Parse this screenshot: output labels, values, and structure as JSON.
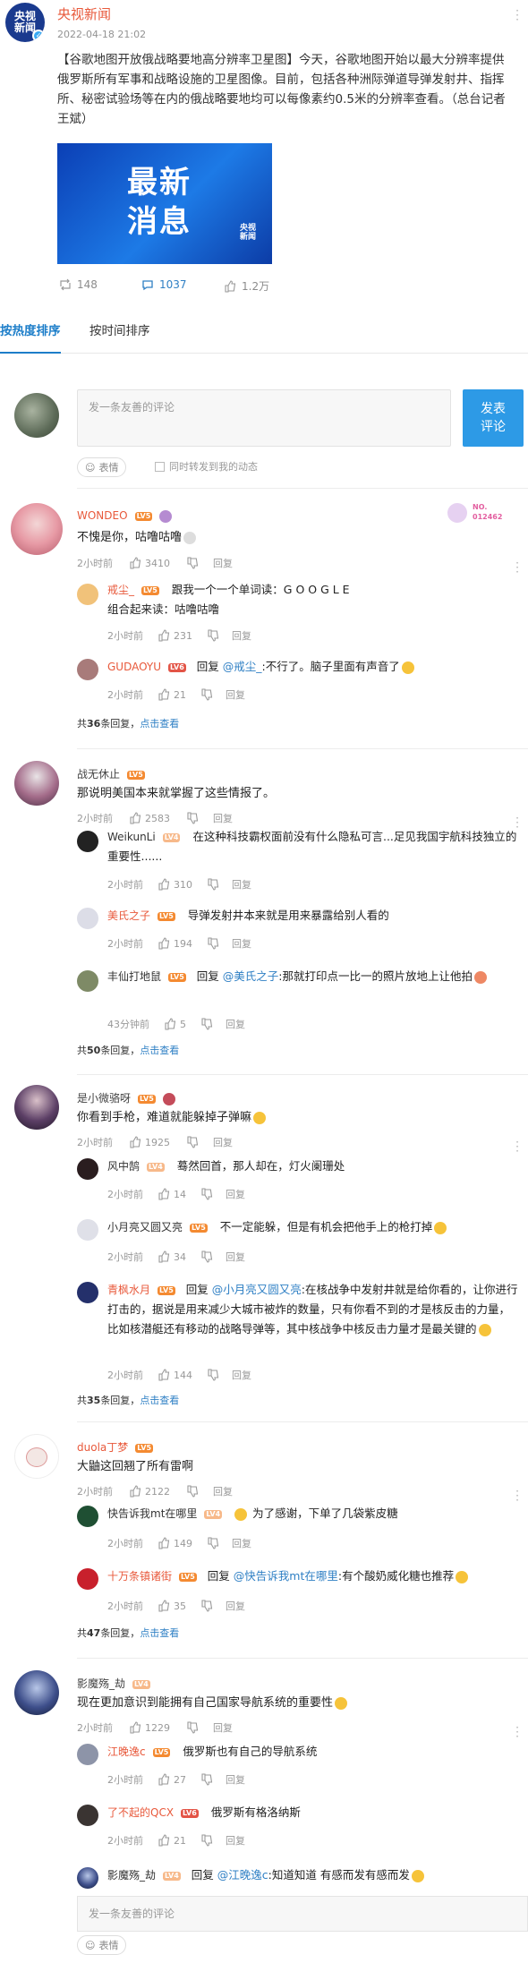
{
  "post": {
    "author": "央视新闻",
    "avatar_line1": "央视",
    "avatar_line2": "新闻",
    "time": "2022-04-18 21:02",
    "text": "【谷歌地图开放俄战略要地高分辨率卫星图】今天，谷歌地图开始以最大分辨率提供俄罗斯所有军事和战略设施的卫星图像。目前，包括各种洲际弹道导弹发射井、指挥所、秘密试验场等在内的俄战略要地均可以每像素约0.5米的分辨率查看。（总台记者王斌）",
    "image_title_line1": "最新",
    "image_title_line2": "消息",
    "image_logo_line1": "央视",
    "image_logo_line2": "新闻",
    "reposts": "148",
    "comments": "1037",
    "likes": "1.2万"
  },
  "tabs": [
    "按热度排序",
    "按时间排序"
  ],
  "composer": {
    "placeholder": "发一条友善的评论",
    "send_line1": "发表",
    "send_line2": "评论",
    "emoji_label": "表情",
    "also_post_label": "同时转发到我的动态"
  },
  "comments": [
    {
      "name": "WONDEO",
      "level": "LV5",
      "text": "不愧是你，咕噜咕噜",
      "time": "2小时前",
      "likes": "3410",
      "reply_label": "回复",
      "badge": "NO.",
      "badge_num": "012462",
      "replies": [
        {
          "name": "戒尘_",
          "level": "LV5",
          "text": "跟我一个一个单词读：G O O G L E",
          "text2": "组合起来读：咕噜咕噜",
          "time": "2小时前",
          "likes": "231"
        },
        {
          "name": "GUDAOYU",
          "level": "LV6",
          "prefix": "回复",
          "mention": "@戒尘_",
          "text": ":不行了。脑子里面有声音了",
          "time": "2小时前",
          "likes": "21"
        }
      ],
      "more_prefix": "共",
      "more_count": "36",
      "more_suffix": "条回复，",
      "more_link": "点击查看"
    },
    {
      "name": "战无休止",
      "level": "LV5",
      "text": "那说明美国本来就掌握了这些情报了。",
      "time": "2小时前",
      "likes": "2583",
      "reply_label": "回复",
      "replies": [
        {
          "name": "WeikunLi",
          "level": "LV4",
          "text": "在这种科技霸权面前没有什么隐私可言...足见我国宇航科技独立的重要性......",
          "time": "2小时前",
          "likes": "310"
        },
        {
          "name": "美氏之子",
          "level": "LV5",
          "text": "导弹发射井本来就是用来暴露给别人看的",
          "time": "2小时前",
          "likes": "194"
        },
        {
          "name": "丰仙打地鼠",
          "level": "LV5",
          "prefix": "回复",
          "mention": "@美氏之子",
          "text": ":那就打印点一比一的照片放地上让他拍",
          "time": "43分钟前",
          "likes": "5"
        }
      ],
      "more_prefix": "共",
      "more_count": "50",
      "more_suffix": "条回复，",
      "more_link": "点击查看"
    },
    {
      "name": "是小微骆呀",
      "level": "LV5",
      "text": "你看到手枪，难道就能躲掉子弹嘛",
      "time": "2小时前",
      "likes": "1925",
      "reply_label": "回复",
      "replies": [
        {
          "name": "风中鹄",
          "level": "LV4",
          "text": "蓦然回首，那人却在，灯火阑珊处",
          "time": "2小时前",
          "likes": "14"
        },
        {
          "name": "小月亮又圆又亮",
          "level": "LV5",
          "text": "不一定能躲，但是有机会把他手上的枪打掉",
          "time": "2小时前",
          "likes": "34"
        },
        {
          "name": "青枫水月",
          "level": "LV5",
          "prefix": "回复",
          "mention": "@小月亮又圆又亮",
          "text": ":在核战争中发射井就是给你看的，让你进行打击的，据说是用来减少大城市被炸的数量，只有你看不到的才是核反击的力量，比如核潜艇还有移动的战略导弹等，其中核战争中核反击力量才是最关键的",
          "time": "2小时前",
          "likes": "144"
        }
      ],
      "more_prefix": "共",
      "more_count": "35",
      "more_suffix": "条回复，",
      "more_link": "点击查看"
    },
    {
      "name": "duola丁梦",
      "level": "LV5",
      "text": "大鼬这回翘了所有雷啊",
      "time": "2小时前",
      "likes": "2122",
      "reply_label": "回复",
      "replies": [
        {
          "name": "快告诉我mt在哪里",
          "level": "LV4",
          "text": "为了感谢，下单了几袋紫皮糖",
          "time": "2小时前",
          "likes": "149"
        },
        {
          "name": "十万条镇诸街",
          "level": "LV5",
          "prefix": "回复",
          "mention": "@快告诉我mt在哪里",
          "text": ":有个酸奶威化糖也推荐",
          "time": "2小时前",
          "likes": "35"
        }
      ],
      "more_prefix": "共",
      "more_count": "47",
      "more_suffix": "条回复，",
      "more_link": "点击查看"
    },
    {
      "name": "影魔殇_劫",
      "level": "LV4",
      "text": "现在更加意识到能拥有自己国家导航系统的重要性",
      "time": "2小时前",
      "likes": "1229",
      "reply_label": "回复",
      "replies": [
        {
          "name": "江晚逸c",
          "level": "LV5",
          "text": "俄罗斯也有自己的导航系统",
          "time": "2小时前",
          "likes": "27"
        },
        {
          "name": "了不起的QCX",
          "level": "LV6",
          "text": "俄罗斯有格洛纳斯",
          "time": "2小时前",
          "likes": "21"
        },
        {
          "name": "影魔殇_劫",
          "level": "LV4",
          "prefix": "回复",
          "mention": "@江晚逸c",
          "text": ":知道知道 有感而发有感而发",
          "time": "",
          "likes": ""
        }
      ]
    }
  ],
  "bottom": {
    "placeholder": "发一条友善的评论",
    "emoji_label": "表情"
  },
  "colors": {
    "accent": "#2d9ae6",
    "username": "#e8593b",
    "level": "#f48a31",
    "link": "#2e7fc4"
  },
  "icons": [
    "repost-icon",
    "comment-icon",
    "like-icon",
    "dislike-icon",
    "more-dots-icon",
    "emoji-icon",
    "verified-icon"
  ]
}
